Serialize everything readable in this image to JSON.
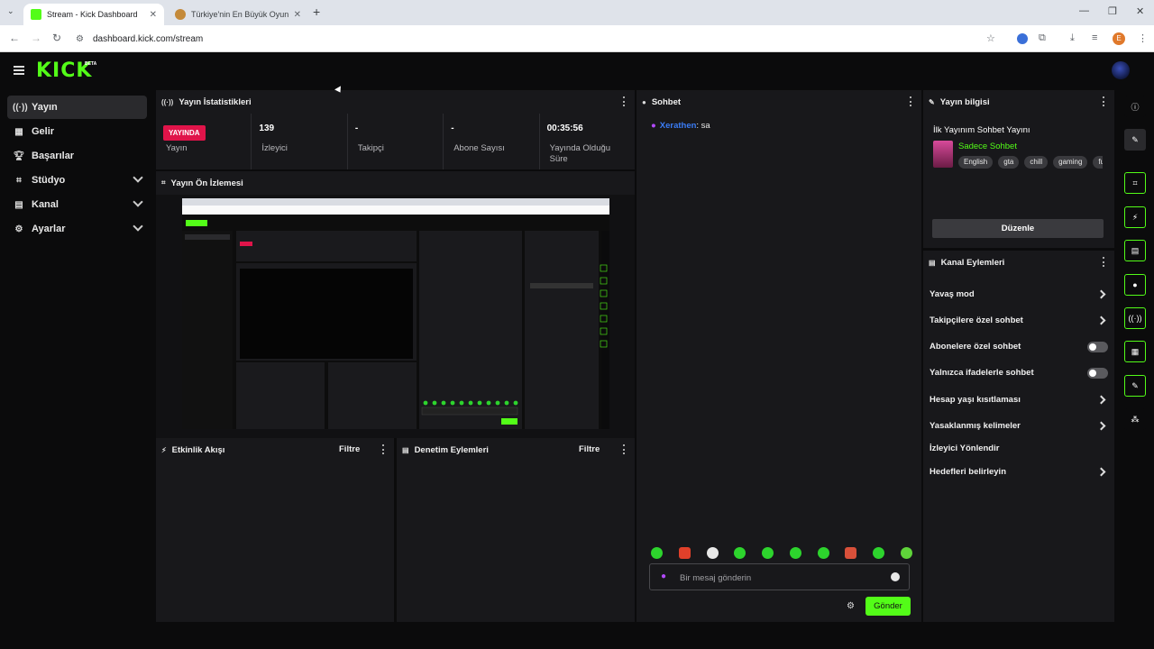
{
  "browser": {
    "tabs": [
      {
        "title": "Stream - Kick Dashboard",
        "active": true
      },
      {
        "title": "Türkiye'nin En Büyük Oyuncu D",
        "active": false
      }
    ],
    "url": "dashboard.kick.com/stream",
    "profile_initial": "E"
  },
  "app": {
    "logo": "KICK",
    "logo_badge": "BETA",
    "accent": "#53fc18",
    "live_color": "#e0144a"
  },
  "sidebar": {
    "items": [
      {
        "label": "Yayın",
        "icon": "broadcast-icon"
      },
      {
        "label": "Gelir",
        "icon": "revenue-icon"
      },
      {
        "label": "Başarılar",
        "icon": "trophy-icon"
      },
      {
        "label": "Stüdyo",
        "icon": "studio-icon"
      },
      {
        "label": "Kanal",
        "icon": "channel-icon"
      },
      {
        "label": "Ayarlar",
        "icon": "gear-icon"
      }
    ]
  },
  "stats": {
    "title": "Yayın İstatistikleri",
    "live_badge": "YAYINDA",
    "items": [
      {
        "value": "",
        "label": "Yayın"
      },
      {
        "value": "139",
        "label": "İzleyici"
      },
      {
        "value": "-",
        "label": "Takipçi"
      },
      {
        "value": "-",
        "label": "Abone Sayısı"
      },
      {
        "value": "00:35:56",
        "label": "Yayında Olduğu Süre"
      }
    ]
  },
  "preview": {
    "title": "Yayın Ön İzlemesi"
  },
  "activity": {
    "title": "Etkinlik Akışı",
    "filter": "Filtre"
  },
  "moderation": {
    "title": "Denetim Eylemleri",
    "filter": "Filtre"
  },
  "chat": {
    "title": "Sohbet",
    "messages": [
      {
        "user": "Xerathen",
        "text": ": sa"
      }
    ],
    "placeholder": "Bir mesaj gönderin",
    "send": "Gönder"
  },
  "stream_info": {
    "title": "Yayın bilgisi",
    "stream_title": "İlk Yayınım Sohbet Yayını",
    "category": "Sadece Sohbet",
    "tags": [
      "English",
      "gta",
      "chill",
      "gaming",
      "fu"
    ],
    "edit": "Düzenle"
  },
  "channel_actions": {
    "title": "Kanal Eylemleri",
    "items": [
      {
        "label": "Yavaş mod",
        "kind": "arrow"
      },
      {
        "label": "Takipçilere özel sohbet",
        "kind": "arrow"
      },
      {
        "label": "Abonelere özel sohbet",
        "kind": "toggle"
      },
      {
        "label": "Yalnızca ifadelerle sohbet",
        "kind": "toggle"
      },
      {
        "label": "Hesap yaşı kısıtlaması",
        "kind": "arrow"
      },
      {
        "label": "Yasaklanmış kelimeler",
        "kind": "arrow"
      },
      {
        "label": "İzleyici Yönlendir",
        "kind": "none"
      },
      {
        "label": "Hedefleri belirleyin",
        "kind": "arrow"
      }
    ]
  }
}
